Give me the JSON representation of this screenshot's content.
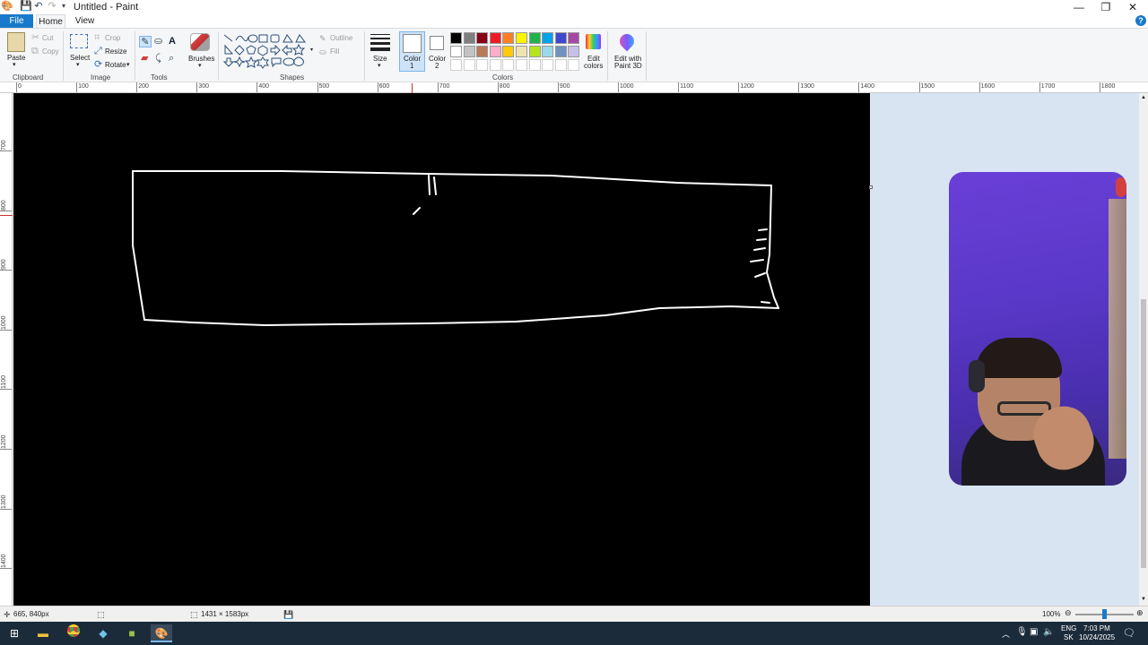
{
  "window": {
    "title": "Untitled - Paint",
    "controls": {
      "minimize": "—",
      "maximize": "❐",
      "close": "✕"
    }
  },
  "tabs": {
    "file": "File",
    "home": "Home",
    "view": "View"
  },
  "clipboard": {
    "paste": "Paste",
    "cut": "Cut",
    "copy": "Copy",
    "group": "Clipboard"
  },
  "image": {
    "select": "Select",
    "crop": "Crop",
    "resize": "Resize",
    "rotate": "Rotate",
    "group": "Image"
  },
  "tools": {
    "group": "Tools",
    "brushes": "Brushes"
  },
  "shapes": {
    "outline": "Outline",
    "fill": "Fill",
    "group": "Shapes"
  },
  "size": {
    "label": "Size"
  },
  "color1": {
    "label_line1": "Color",
    "label_line2": "1"
  },
  "color2": {
    "label_line1": "Color",
    "label_line2": "2"
  },
  "colors": {
    "group": "Colors",
    "row1": [
      "#000000",
      "#7f7f7f",
      "#880015",
      "#ed1c24",
      "#ff7f27",
      "#fff200",
      "#22b14c",
      "#00a2e8",
      "#3f48cc",
      "#a349a4"
    ],
    "row2": [
      "#ffffff",
      "#c3c3c3",
      "#b97a57",
      "#ffaec9",
      "#ffc90e",
      "#efe4b0",
      "#b5e61d",
      "#99d9ea",
      "#7092be",
      "#c8bfe7"
    ],
    "row3_empty": 10
  },
  "edit_colors": {
    "line1": "Edit",
    "line2": "colors"
  },
  "paint3d": {
    "line1": "Edit with",
    "line2": "Paint 3D"
  },
  "ruler_top": [
    "0",
    "100",
    "200",
    "300",
    "400",
    "500",
    "600",
    "700",
    "800",
    "900",
    "1000",
    "1100",
    "1200",
    "1300",
    "1400",
    "1500",
    "1600",
    "1700",
    "1800"
  ],
  "ruler_left": [
    "700",
    "800",
    "900",
    "1000",
    "1100",
    "1200",
    "1300",
    "1400"
  ],
  "status": {
    "cursor_pos": "665, 840px",
    "image_size": "1431 × 1583px",
    "zoom": "100%"
  },
  "taskbar": {
    "lang_line1": "ENG",
    "lang_line2": "SK",
    "time": "7:03 PM",
    "date": "10/24/2025"
  }
}
